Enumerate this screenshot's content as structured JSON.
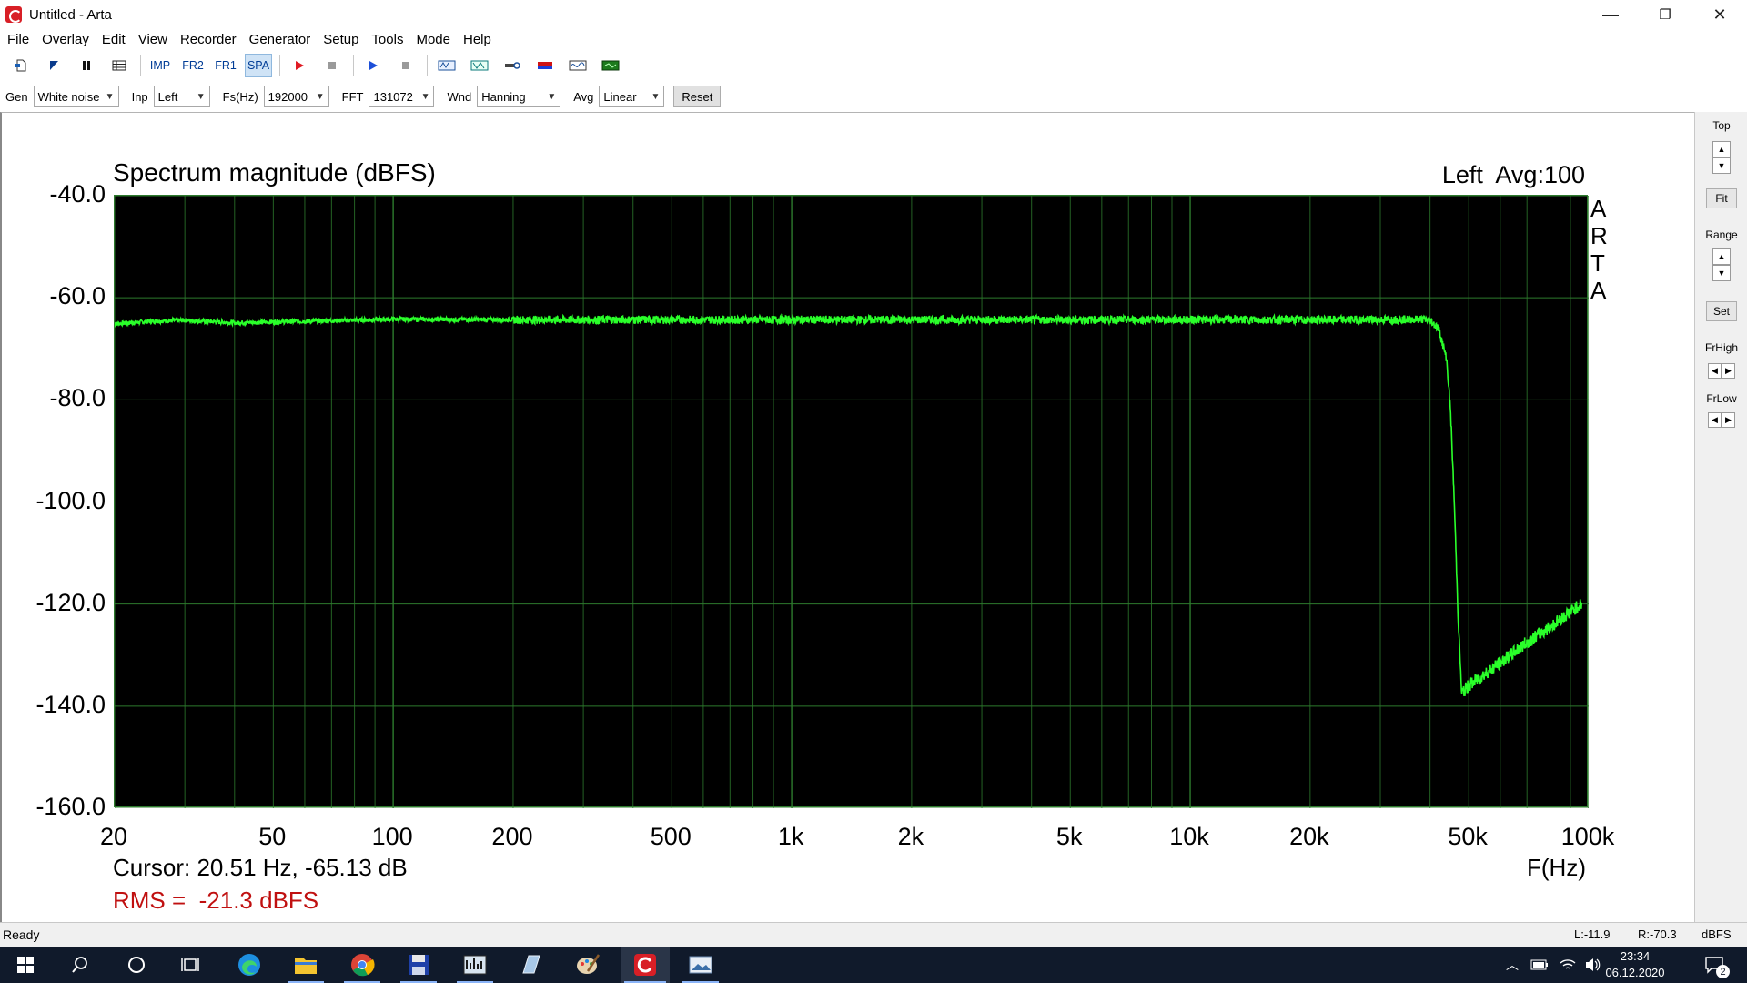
{
  "window": {
    "title": "Untitled - Arta",
    "controls": [
      "—",
      "❐",
      "✕"
    ]
  },
  "menu": [
    "File",
    "Overlay",
    "Edit",
    "View",
    "Recorder",
    "Generator",
    "Setup",
    "Tools",
    "Mode",
    "Help"
  ],
  "toolbar": {
    "imp": "IMP",
    "fr2": "FR2",
    "fr1": "FR1",
    "spa": "SPA"
  },
  "settings": {
    "gen_label": "Gen",
    "gen_value": "White noise",
    "inp_label": "Inp",
    "inp_value": "Left",
    "fs_label": "Fs(Hz)",
    "fs_value": "192000",
    "fft_label": "FFT",
    "fft_value": "131072",
    "wnd_label": "Wnd",
    "wnd_value": "Hanning",
    "avg_label": "Avg",
    "avg_value": "Linear",
    "reset_label": "Reset"
  },
  "plot": {
    "status": "Left  Avg:100",
    "arta_letters": [
      "A",
      "R",
      "T",
      "A"
    ],
    "cursor": "Cursor: 20.51 Hz, -65.13 dB",
    "rms": "RMS =  -21.3 dBFS"
  },
  "chart_data": {
    "type": "line",
    "title": "Spectrum magnitude (dBFS)",
    "xlabel": "F(Hz)",
    "ylabel": "",
    "x_scale": "log",
    "xlim": [
      20,
      100000
    ],
    "ylim": [
      -160,
      -40
    ],
    "x_ticks": [
      {
        "v": 20,
        "label": "20"
      },
      {
        "v": 50,
        "label": "50"
      },
      {
        "v": 100,
        "label": "100"
      },
      {
        "v": 200,
        "label": "200"
      },
      {
        "v": 500,
        "label": "500"
      },
      {
        "v": 1000,
        "label": "1k"
      },
      {
        "v": 2000,
        "label": "2k"
      },
      {
        "v": 5000,
        "label": "5k"
      },
      {
        "v": 10000,
        "label": "10k"
      },
      {
        "v": 20000,
        "label": "20k"
      },
      {
        "v": 50000,
        "label": "50k"
      },
      {
        "v": 100000,
        "label": "100k"
      }
    ],
    "y_ticks": [
      {
        "v": -40,
        "label": "-40.0"
      },
      {
        "v": -60,
        "label": "-60.0"
      },
      {
        "v": -80,
        "label": "-80.0"
      },
      {
        "v": -100,
        "label": "-100.0"
      },
      {
        "v": -120,
        "label": "-120.0"
      },
      {
        "v": -140,
        "label": "-140.0"
      },
      {
        "v": -160,
        "label": "-160.0"
      }
    ],
    "grid": true,
    "line_color": "#2aff2a",
    "grid_color": "#2d7a2d",
    "background": "#000000",
    "series": [
      {
        "x": [
          20,
          25,
          30,
          40,
          60,
          100,
          200,
          500,
          1000,
          2000,
          5000,
          10000,
          20000,
          30000,
          38000,
          40000,
          42000,
          44000,
          45000,
          46000,
          47000,
          48000,
          50000,
          60000,
          70000,
          80000,
          90000,
          96000
        ],
        "y": [
          -65.1,
          -64.6,
          -64.4,
          -64.9,
          -64.6,
          -64.2,
          -64.3,
          -64.3,
          -64.3,
          -64.3,
          -64.3,
          -64.3,
          -64.3,
          -64.3,
          -64.2,
          -64.4,
          -66,
          -72,
          -82,
          -100,
          -122,
          -137.5,
          -136,
          -131.5,
          -127.5,
          -124.5,
          -121.5,
          -120
        ]
      }
    ]
  },
  "rpanel": {
    "top_label": "Top",
    "fit_label": "Fit",
    "range_label": "Range",
    "set_label": "Set",
    "frhigh_label": "FrHigh",
    "frlow_label": "FrLow"
  },
  "status": {
    "ready": "Ready",
    "left_level": "L:-11.9",
    "right_level": "R:-70.3",
    "unit": "dBFS"
  },
  "taskbar": {
    "time": "23:34",
    "date": "06.12.2020",
    "notification_count": "2"
  }
}
